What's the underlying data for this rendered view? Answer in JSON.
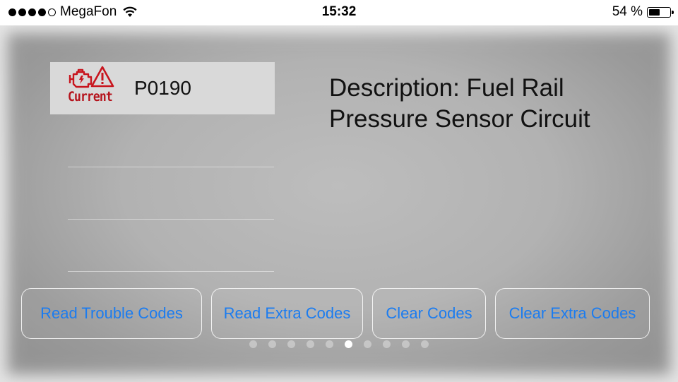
{
  "status_bar": {
    "carrier": "MegaFon",
    "time": "15:32",
    "battery_percent": "54 %",
    "battery_level": 0.54,
    "signal_bars_filled": 4,
    "signal_bars_total": 5,
    "icons": [
      "signal-dots-icon",
      "wifi-icon",
      "battery-icon"
    ]
  },
  "trouble_code": {
    "status_label": "Current",
    "code": "P0190",
    "icon": "engine-warning-icon",
    "status_color": "#b5121b"
  },
  "description": {
    "text": "Description: Fuel Rail Pressure Sensor Circuit"
  },
  "buttons": {
    "read_trouble_codes": "Read Trouble Codes",
    "read_extra_codes": "Read Extra Codes",
    "clear_codes": "Clear Codes",
    "clear_extra_codes": "Clear Extra Codes"
  },
  "page_indicator": {
    "total": 10,
    "current": 6
  },
  "colors": {
    "accent": "#1b7cf0",
    "background": "#b2b2b2"
  }
}
